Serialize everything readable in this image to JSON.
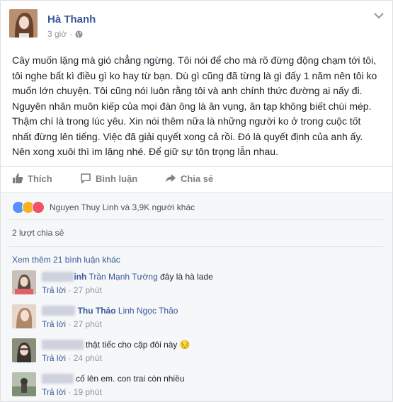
{
  "post": {
    "author": "Hà Thanh",
    "time": "3 giờ",
    "text": "Cây muốn lặng mà gió chẳng ngừng. Tôi nói để cho mà rõ đừng động chạm tới tôi, tôi nghe bất kì điều gì ko hay từ bạn. Dù gì cũng đã từng là gì đấy 1 năm nên tôi ko muốn lớn chuyện. Tôi cũng nói luôn rằng tôi và anh chính thức đường ai nấy đi. Nguyên nhân muôn kiếp của mọi đàn ông là ăn vụng, ăn tạp không biết chùi mép. Thậm chí là trong lúc yêu. Xin nói thêm nữa là những người ko ở trong cuộc tốt nhất đừng lên tiếng. Việc đã giải quyết xong cả rồi. Đó là quyết định của anh ấy. Nên xong xuôi thì im lặng nhé. Để giữ sự tôn trọng lẫn nhau.",
    "actions": {
      "like": "Thích",
      "comment": "Bình luận",
      "share": "Chia sẻ"
    }
  },
  "feedback": {
    "reactions_text": "Nguyen Thuy Linh và 3,9K người khác",
    "shares_text": "2 lượt chia sẻ",
    "view_more": "Xem thêm 21 bình luận khác",
    "reply_label": "Trả lời",
    "dot": "·",
    "reaction_colors": [
      "#5890ff",
      "#f7b125",
      "#f25268"
    ],
    "comments": [
      {
        "name_visible": "inh",
        "mention": "Trần Mạnh Tường",
        "text": "đây là hà lade",
        "time": "27 phút"
      },
      {
        "name_visible": "Thu Thảo",
        "mention": "Linh Ngọc Thảo",
        "text": "",
        "time": "27 phút"
      },
      {
        "name_visible": "",
        "mention": "",
        "text": "thật tiếc cho cặp đôi này 😔",
        "time": "24 phút"
      },
      {
        "name_visible": "",
        "mention": "",
        "text": "cố lên em. con trai còn nhiều",
        "time": "19 phút"
      }
    ]
  }
}
